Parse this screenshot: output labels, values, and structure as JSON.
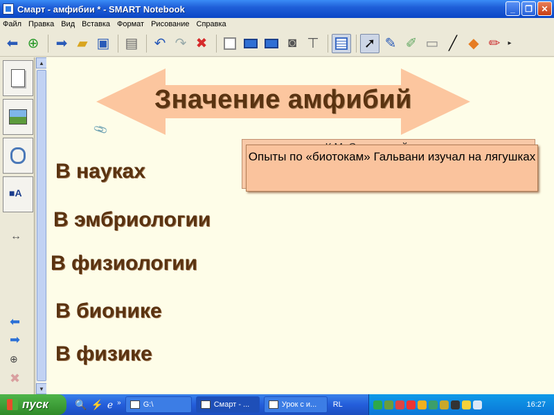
{
  "window": {
    "title": "Смарт - амфибии * - SMART Notebook",
    "minimize": "_",
    "maximize": "❐",
    "close": "✕"
  },
  "menu": [
    "Файл",
    "Правка",
    "Вид",
    "Вставка",
    "Формат",
    "Рисование",
    "Справка"
  ],
  "canvas": {
    "heading": "Значение амфибий",
    "topics": [
      "В науках",
      "В эмбриологии",
      "В физиологии",
      "В бионике",
      "В физике"
    ],
    "info_back_text": "К.М. С... нервной системы",
    "info_front_text": "Опыты по  «биотокам» Гальвани изучал на лягушках"
  },
  "colors": {
    "arrow_fill": "#fcc69f",
    "canvas_bg": "#fefde8",
    "heading_text": "#5a3311"
  },
  "taskbar": {
    "start": "пуск",
    "tasks": [
      "G:\\",
      "Смарт - ...",
      "Урок с и..."
    ],
    "lang": "RL",
    "clock": "16:27"
  }
}
